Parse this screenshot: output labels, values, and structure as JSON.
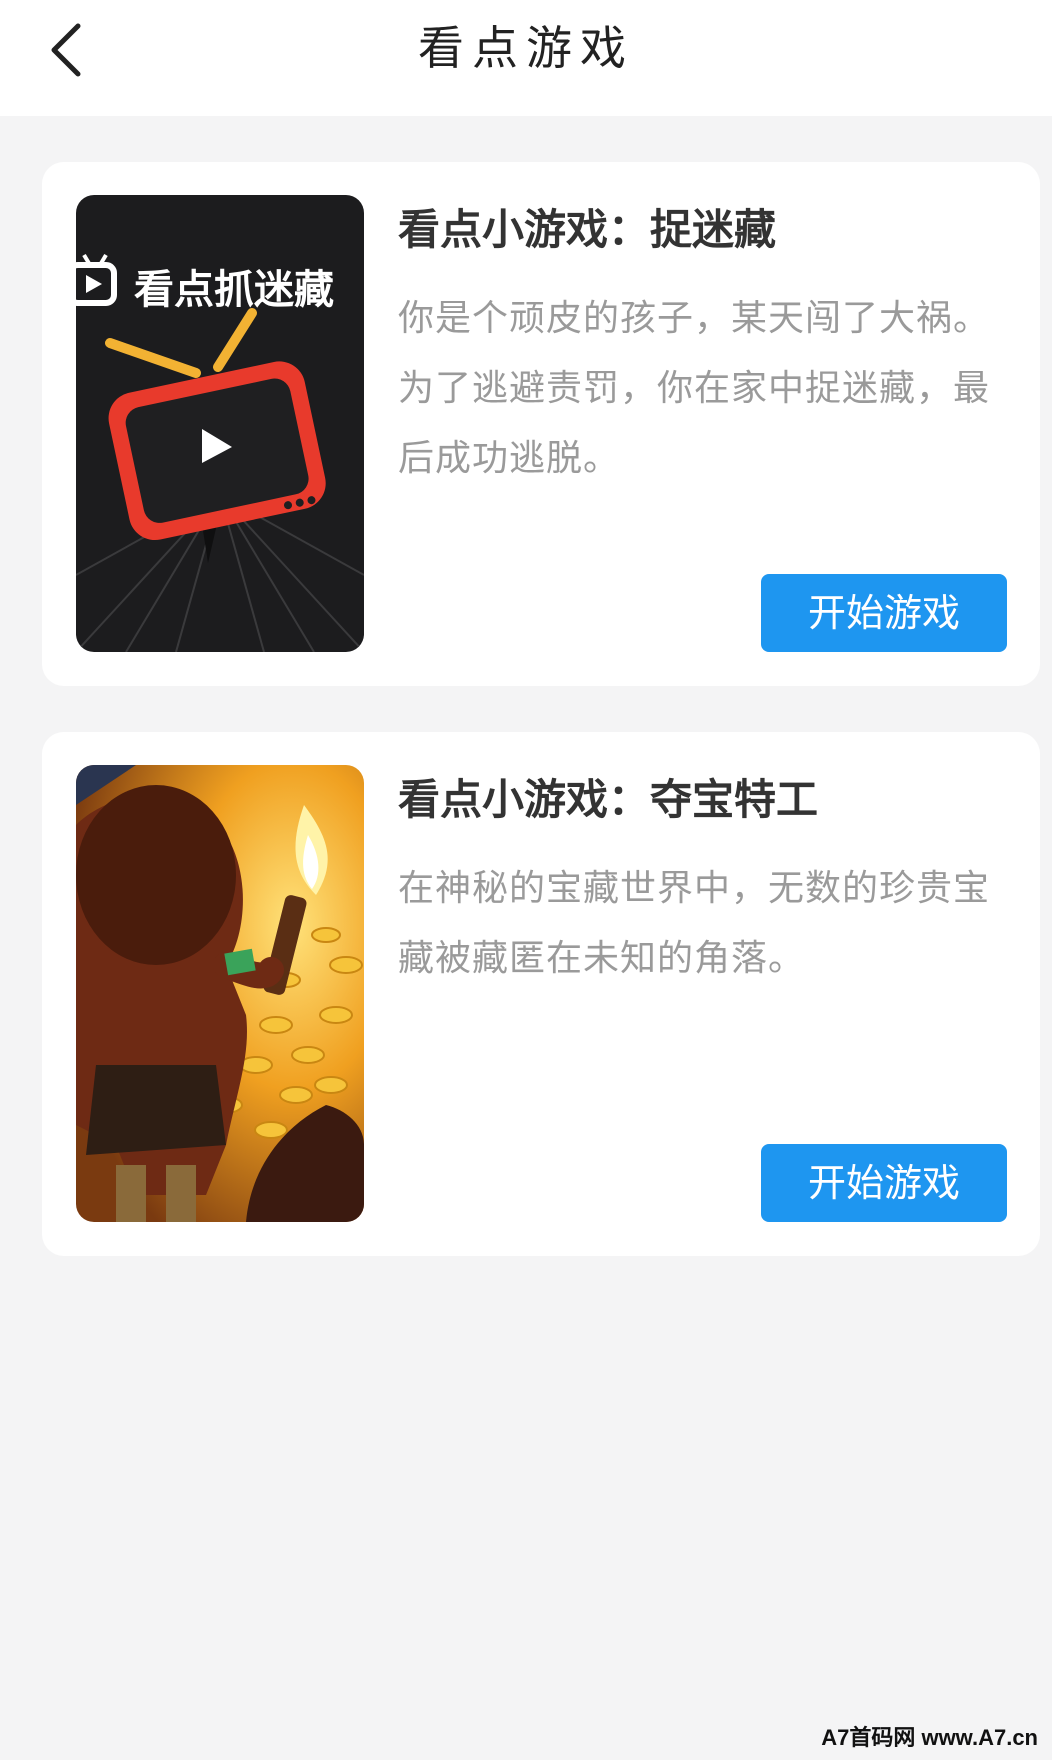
{
  "header": {
    "title": "看点游戏",
    "back_icon": "chevron-left-icon"
  },
  "games": [
    {
      "title": "看点小游戏：捉迷藏",
      "description": "你是个顽皮的孩子，某天闯了大祸。为了逃避责罚，你在家中捉迷藏，最后成功逃脱。",
      "thumb_text": "看点抓迷藏",
      "button_label": "开始游戏"
    },
    {
      "title": "看点小游戏：夺宝特工",
      "description": "在神秘的宝藏世界中，无数的珍贵宝藏被藏匿在未知的角落。",
      "button_label": "开始游戏"
    }
  ],
  "watermark": "A7首码网 www.A7.cn",
  "colors": {
    "button": "#1e96f0",
    "background": "#f4f4f5",
    "tv_red": "#e83a2c"
  }
}
